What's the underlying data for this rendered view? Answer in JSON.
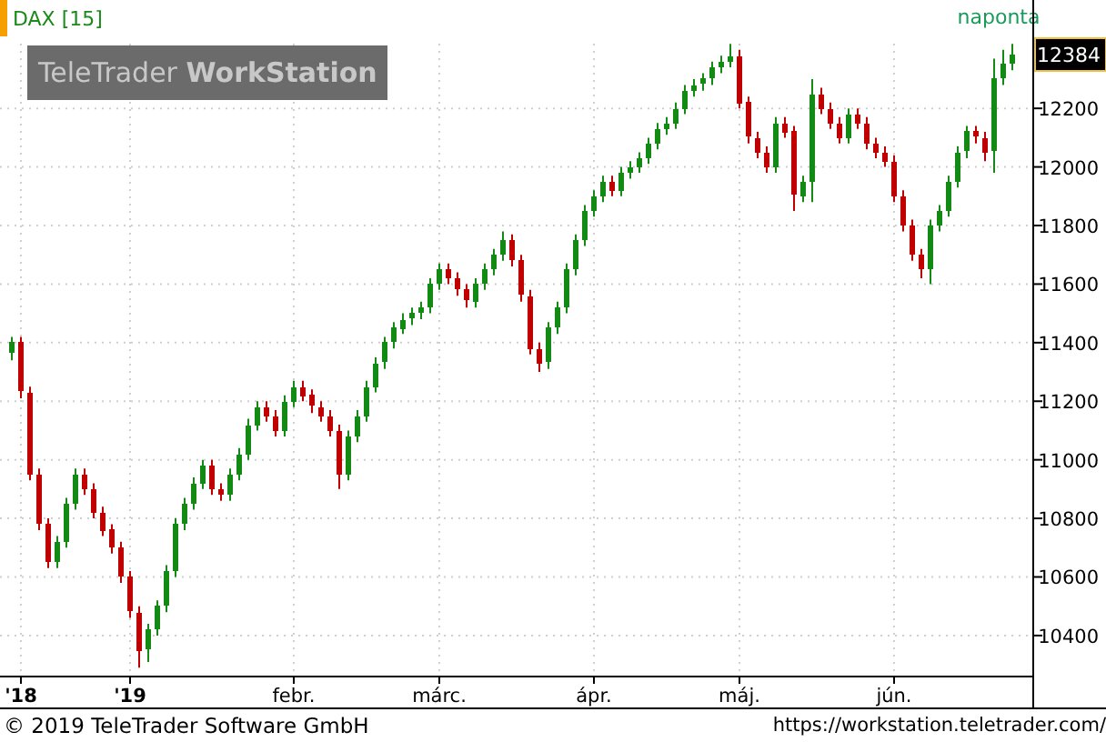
{
  "logo": "TeleTrader **WorkStation**",
  "period": "naponta",
  "chart": {
    "chart_data": {
      "type": "candlestick",
      "title": "DAX [15]",
      "categories": [
        null,
        "'18",
        null,
        null,
        null,
        null,
        null,
        null,
        null,
        null,
        null,
        null,
        null,
        "'19",
        null,
        null,
        null,
        null,
        null,
        null,
        null,
        null,
        null,
        null,
        null,
        null,
        null,
        null,
        null,
        null,
        null,
        "febr.",
        null,
        null,
        null,
        null,
        null,
        null,
        null,
        null,
        null,
        null,
        null,
        null,
        null,
        null,
        null,
        "márc.",
        null,
        null,
        null,
        null,
        null,
        null,
        null,
        null,
        null,
        null,
        null,
        null,
        null,
        null,
        null,
        null,
        "ápr.",
        null,
        null,
        null,
        null,
        null,
        null,
        null,
        null,
        null,
        null,
        null,
        null,
        null,
        null,
        null,
        "máj.",
        null,
        null,
        null,
        null,
        null,
        null,
        null,
        null,
        null,
        null,
        null,
        null,
        null,
        null,
        null,
        null,
        "jún.",
        null,
        null,
        null,
        null,
        null,
        null,
        null,
        null,
        null,
        null,
        null,
        null,
        null
      ],
      "ohlc": [
        [
          11360,
          11420,
          11340,
          11400
        ],
        [
          11400,
          11420,
          11210,
          11230
        ],
        [
          11230,
          11250,
          10930,
          10950
        ],
        [
          10950,
          10970,
          10760,
          10780
        ],
        [
          10780,
          10800,
          10630,
          10650
        ],
        [
          10650,
          10740,
          10630,
          10720
        ],
        [
          10720,
          10870,
          10700,
          10850
        ],
        [
          10850,
          10970,
          10830,
          10950
        ],
        [
          10950,
          10970,
          10880,
          10900
        ],
        [
          10900,
          10920,
          10800,
          10820
        ],
        [
          10820,
          10840,
          10740,
          10760
        ],
        [
          10760,
          10780,
          10680,
          10700
        ],
        [
          10700,
          10720,
          10580,
          10600
        ],
        [
          10600,
          10620,
          10460,
          10480
        ],
        [
          10480,
          10500,
          10290,
          10350
        ],
        [
          10350,
          10440,
          10310,
          10420
        ],
        [
          10420,
          10520,
          10400,
          10500
        ],
        [
          10500,
          10640,
          10480,
          10620
        ],
        [
          10620,
          10800,
          10600,
          10780
        ],
        [
          10780,
          10870,
          10760,
          10850
        ],
        [
          10850,
          10940,
          10830,
          10920
        ],
        [
          10920,
          11000,
          10900,
          10980
        ],
        [
          10980,
          11000,
          10880,
          10900
        ],
        [
          10900,
          10920,
          10860,
          10880
        ],
        [
          10880,
          10970,
          10860,
          10950
        ],
        [
          10950,
          11040,
          10930,
          11020
        ],
        [
          11020,
          11140,
          11000,
          11120
        ],
        [
          11120,
          11200,
          11100,
          11180
        ],
        [
          11180,
          11200,
          11130,
          11150
        ],
        [
          11150,
          11170,
          11080,
          11100
        ],
        [
          11100,
          11220,
          11080,
          11200
        ],
        [
          11200,
          11270,
          11180,
          11250
        ],
        [
          11250,
          11270,
          11200,
          11220
        ],
        [
          11220,
          11240,
          11160,
          11180
        ],
        [
          11180,
          11200,
          11130,
          11150
        ],
        [
          11150,
          11170,
          11080,
          11100
        ],
        [
          11100,
          11120,
          10900,
          10950
        ],
        [
          10950,
          11100,
          10930,
          11080
        ],
        [
          11080,
          11170,
          11060,
          11150
        ],
        [
          11150,
          11270,
          11130,
          11250
        ],
        [
          11250,
          11350,
          11230,
          11330
        ],
        [
          11330,
          11420,
          11310,
          11400
        ],
        [
          11400,
          11470,
          11380,
          11450
        ],
        [
          11450,
          11500,
          11430,
          11480
        ],
        [
          11480,
          11520,
          11460,
          11500
        ],
        [
          11500,
          11540,
          11480,
          11520
        ],
        [
          11520,
          11620,
          11500,
          11600
        ],
        [
          11600,
          11670,
          11580,
          11650
        ],
        [
          11650,
          11670,
          11600,
          11620
        ],
        [
          11620,
          11640,
          11560,
          11580
        ],
        [
          11580,
          11600,
          11520,
          11540
        ],
        [
          11540,
          11620,
          11520,
          11600
        ],
        [
          11600,
          11670,
          11580,
          11650
        ],
        [
          11650,
          11720,
          11630,
          11700
        ],
        [
          11700,
          11780,
          11680,
          11750
        ],
        [
          11750,
          11770,
          11660,
          11680
        ],
        [
          11680,
          11700,
          11540,
          11560
        ],
        [
          11560,
          11580,
          11360,
          11380
        ],
        [
          11380,
          11400,
          11300,
          11330
        ],
        [
          11330,
          11470,
          11310,
          11450
        ],
        [
          11450,
          11540,
          11430,
          11520
        ],
        [
          11520,
          11670,
          11500,
          11650
        ],
        [
          11650,
          11770,
          11630,
          11750
        ],
        [
          11750,
          11870,
          11730,
          11850
        ],
        [
          11850,
          11920,
          11830,
          11900
        ],
        [
          11900,
          11970,
          11880,
          11950
        ],
        [
          11950,
          11970,
          11900,
          11920
        ],
        [
          11920,
          12000,
          11900,
          11980
        ],
        [
          11980,
          12020,
          11960,
          12000
        ],
        [
          12000,
          12050,
          11980,
          12030
        ],
        [
          12030,
          12100,
          12010,
          12080
        ],
        [
          12080,
          12150,
          12060,
          12130
        ],
        [
          12130,
          12170,
          12110,
          12150
        ],
        [
          12150,
          12220,
          12130,
          12200
        ],
        [
          12200,
          12280,
          12180,
          12260
        ],
        [
          12260,
          12300,
          12240,
          12280
        ],
        [
          12280,
          12320,
          12260,
          12300
        ],
        [
          12300,
          12360,
          12280,
          12340
        ],
        [
          12340,
          12380,
          12320,
          12360
        ],
        [
          12360,
          12420,
          12340,
          12380
        ],
        [
          12380,
          12400,
          12200,
          12220
        ],
        [
          12220,
          12240,
          12080,
          12100
        ],
        [
          12100,
          12120,
          12030,
          12050
        ],
        [
          12050,
          12070,
          11980,
          12000
        ],
        [
          12000,
          12170,
          11980,
          12150
        ],
        [
          12150,
          12170,
          12100,
          12120
        ],
        [
          12120,
          12140,
          11850,
          11900
        ],
        [
          11900,
          11970,
          11880,
          11950
        ],
        [
          11950,
          12300,
          11880,
          12250
        ],
        [
          12250,
          12270,
          12180,
          12200
        ],
        [
          12200,
          12220,
          12130,
          12150
        ],
        [
          12150,
          12170,
          12080,
          12100
        ],
        [
          12100,
          12200,
          12080,
          12180
        ],
        [
          12180,
          12200,
          12130,
          12150
        ],
        [
          12150,
          12170,
          12060,
          12080
        ],
        [
          12080,
          12100,
          12030,
          12050
        ],
        [
          12050,
          12070,
          12000,
          12020
        ],
        [
          12020,
          12040,
          11880,
          11900
        ],
        [
          11900,
          11920,
          11780,
          11800
        ],
        [
          11800,
          11820,
          11680,
          11700
        ],
        [
          11700,
          11720,
          11620,
          11650
        ],
        [
          11650,
          11820,
          11600,
          11800
        ],
        [
          11800,
          11870,
          11780,
          11850
        ],
        [
          11850,
          11970,
          11830,
          11950
        ],
        [
          11950,
          12070,
          11930,
          12050
        ],
        [
          12050,
          12140,
          12030,
          12120
        ],
        [
          12120,
          12140,
          12080,
          12100
        ],
        [
          12100,
          12120,
          12020,
          12050
        ],
        [
          12050,
          12370,
          11980,
          12300
        ],
        [
          12300,
          12400,
          12280,
          12350
        ],
        [
          12350,
          12420,
          12330,
          12384
        ]
      ],
      "ylim": [
        10260,
        12570
      ],
      "grid": true,
      "yticks": [
        10400,
        10600,
        10800,
        11000,
        11200,
        11400,
        11600,
        11800,
        12000,
        12200
      ]
    },
    "last_price": "12384"
  },
  "footer": {
    "copyright": "© 2019 TeleTrader Software GmbH",
    "url": "https://workstation.teletrader.com/"
  }
}
